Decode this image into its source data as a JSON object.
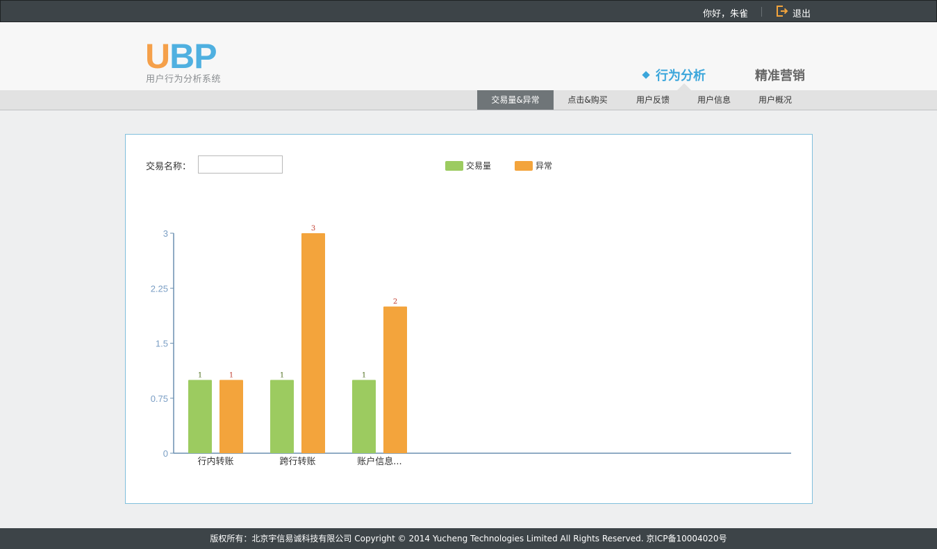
{
  "topbar": {
    "greeting": "你好，朱雀",
    "logout_label": "退出",
    "logout_icon": "logout-icon"
  },
  "logo": {
    "letter_u": "U",
    "letters_bp": "BP",
    "subtitle": "用户行为分析系统"
  },
  "main_nav": {
    "active": "行为分析",
    "other": "精准营销"
  },
  "sub_nav": {
    "items": [
      "交易量&异常",
      "点击&购买",
      "用户反馈",
      "用户信息",
      "用户概况"
    ],
    "active_index": 0
  },
  "filter": {
    "label": "交易名称：",
    "value": ""
  },
  "colors": {
    "volume": "#9ccb60",
    "anomaly": "#f3a43c",
    "axis": "#6a8fb0",
    "tick_label": "#7a9ec4",
    "value_label_volume": "#4a6b1a",
    "value_label_anomaly": "#c0392b"
  },
  "chart_data": {
    "type": "bar",
    "categories": [
      "行内转账",
      "跨行转账",
      "账户信息..."
    ],
    "series": [
      {
        "name": "交易量",
        "values": [
          1,
          1,
          1
        ]
      },
      {
        "name": "异常",
        "values": [
          1,
          3,
          2
        ]
      }
    ],
    "ylim": [
      0,
      3
    ],
    "yticks": [
      "0",
      "0.75",
      "1.5",
      "2.25",
      "3"
    ],
    "legend_position": "top",
    "grid": false
  },
  "footer": {
    "text": "版权所有：北京宇信易诚科技有限公司 Copyright © 2014 Yucheng Technologies Limited All Rights Reserved. 京ICP备10004020号"
  }
}
